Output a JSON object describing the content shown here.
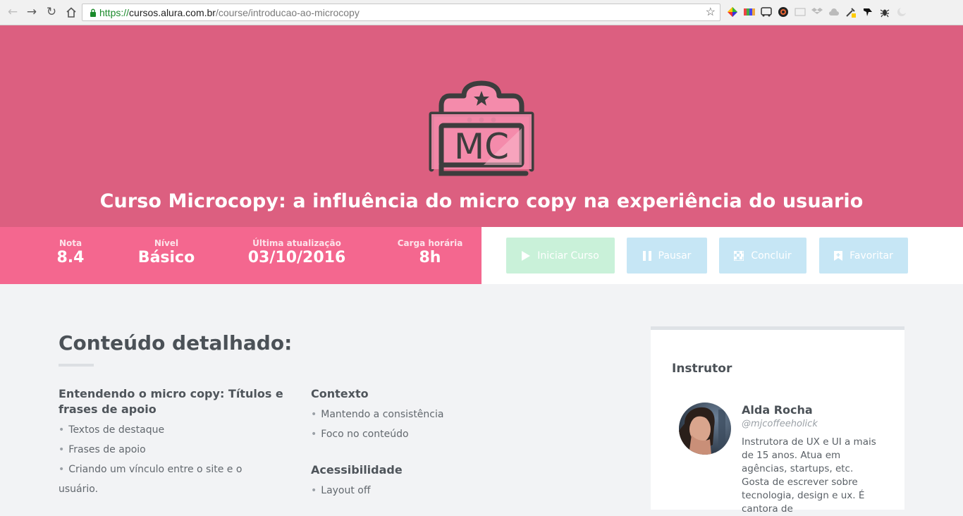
{
  "browser": {
    "url_scheme": "https://",
    "url_host": "cursos.alura.com.br",
    "url_path": "/course/introducao-ao-microcopy"
  },
  "hero": {
    "logo_text": "MC",
    "title": "Curso Microcopy: a influência do micro copy na experiência do usuario",
    "background_color": "#dc5f80"
  },
  "stats": [
    {
      "label": "Nota",
      "value": "8.4"
    },
    {
      "label": "Nível",
      "value": "Básico"
    },
    {
      "label": "Última atualização",
      "value": "03/10/2016"
    },
    {
      "label": "Carga horária",
      "value": "8h"
    }
  ],
  "actions": {
    "start": "Iniciar Curso",
    "pause": "Pausar",
    "done": "Concluir",
    "favorite": "Favoritar"
  },
  "content": {
    "title": "Conteúdo detalhado:",
    "sections": [
      {
        "title": "Entendendo o micro copy: Títulos e frases de apoio",
        "items": [
          "Textos de destaque",
          "Frases de apoio",
          "Criando um vínculo entre o site e o usuário."
        ]
      },
      {
        "title": "Contexto",
        "items": [
          "Mantendo a consistência",
          "Foco no conteúdo"
        ]
      },
      {
        "title": "Acessibilidade",
        "items": [
          "Layout off"
        ]
      }
    ]
  },
  "instructor": {
    "heading": "Instrutor",
    "name": "Alda Rocha",
    "handle": "@mjcoffeeholick",
    "bio": "Instrutora de UX e UI a mais de 15 anos. Atua em agências, startups, etc. Gosta de escrever sobre tecnologia, design e ux. É cantora de"
  },
  "colors": {
    "stats_bg": "#f4678f",
    "start_btn": "#c9f1d9",
    "secondary_btn": "#c6e6f5"
  }
}
